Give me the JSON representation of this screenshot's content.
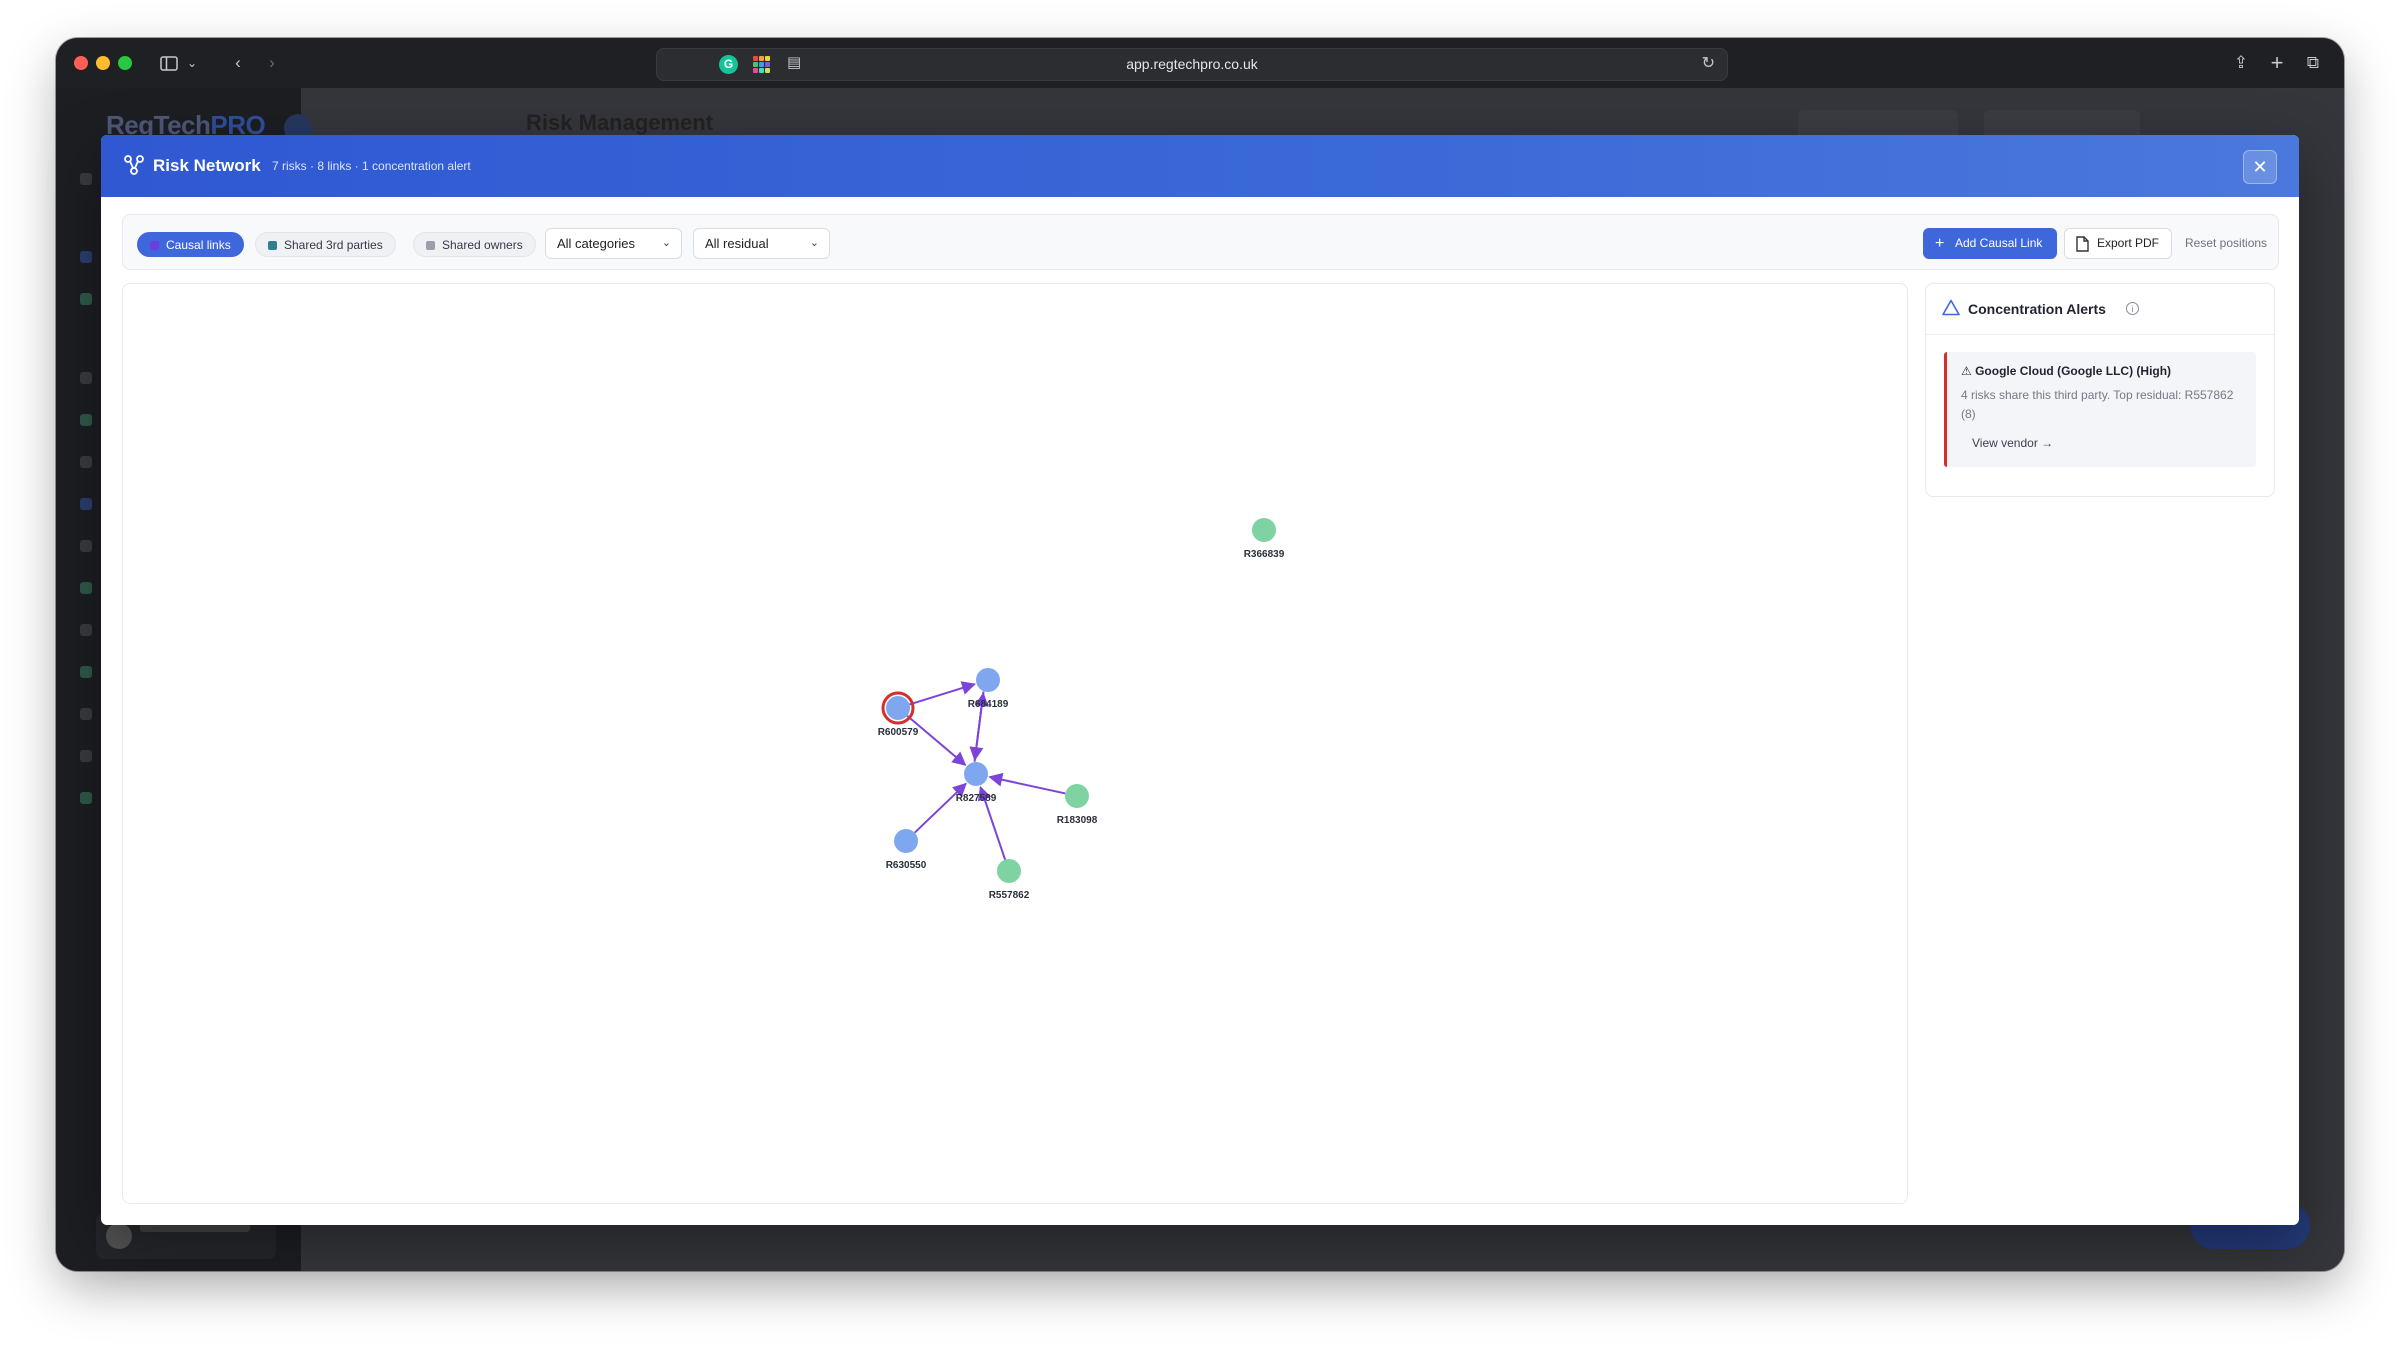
{
  "browser": {
    "url": "app.regtechpro.co.uk",
    "extension_g_label": "G"
  },
  "background_app": {
    "logo_text": "RegTech",
    "logo_suffix": "PRO",
    "page_title": "Risk Management"
  },
  "modal": {
    "title": "Risk Network",
    "subtitle": "7 risks · 8 links · 1 concentration alert",
    "close_label": "✕"
  },
  "toolbar": {
    "filters": [
      {
        "label": "Causal links",
        "active": true,
        "swatch": "#6a3fe0"
      },
      {
        "label": "Shared 3rd parties",
        "active": false,
        "swatch": "#2f7f8f"
      },
      {
        "label": "Shared owners",
        "active": false,
        "swatch": "#9aa0ab"
      }
    ],
    "category_select": "All categories",
    "residual_select": "All residual",
    "add_causal_link": "Add Causal Link",
    "export_pdf": "Export PDF",
    "reset_positions": "Reset positions"
  },
  "graph": {
    "nodes": [
      {
        "id": "R366839",
        "color": "#7fd3a3",
        "alert": false
      },
      {
        "id": "R684189",
        "color": "#7ea7f0",
        "alert": false
      },
      {
        "id": "R600579",
        "color": "#7ea7f0",
        "alert": true
      },
      {
        "id": "R827589",
        "color": "#7ea7f0",
        "alert": false
      },
      {
        "id": "R183098",
        "color": "#7fd3a3",
        "alert": false
      },
      {
        "id": "R630550",
        "color": "#7ea7f0",
        "alert": false
      },
      {
        "id": "R557862",
        "color": "#7fd3a3",
        "alert": false
      }
    ],
    "edges": [
      {
        "from": "R600579",
        "to": "R684189"
      },
      {
        "from": "R600579",
        "to": "R827589"
      },
      {
        "from": "R827589",
        "to": "R684189"
      },
      {
        "from": "R684189",
        "to": "R827589"
      },
      {
        "from": "R183098",
        "to": "R827589"
      },
      {
        "from": "R630550",
        "to": "R827589"
      },
      {
        "from": "R557862",
        "to": "R827589"
      }
    ],
    "edge_color": "#7b45d8",
    "alert_ring_color": "#d32f2f"
  },
  "alerts": {
    "title": "Concentration Alerts",
    "info_label": "i",
    "items": [
      {
        "title": "⚠ Google Cloud (Google LLC) (High)",
        "body": "4 risks share this third party. Top residual: R557862 (8)",
        "link": "View vendor →"
      }
    ]
  }
}
